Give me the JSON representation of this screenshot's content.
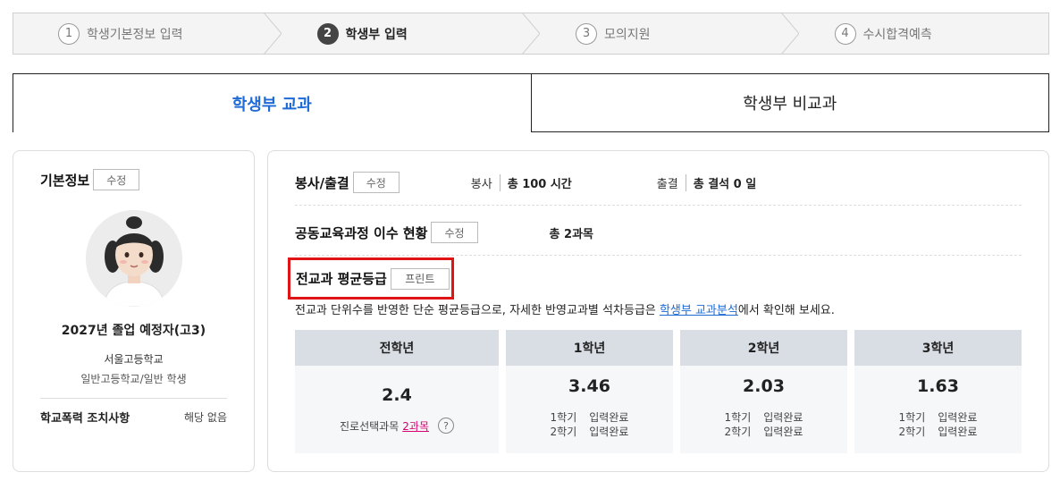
{
  "stepper": {
    "steps": [
      {
        "num": "1",
        "label": "학생기본정보 입력"
      },
      {
        "num": "2",
        "label": "학생부 입력"
      },
      {
        "num": "3",
        "label": "모의지원"
      },
      {
        "num": "4",
        "label": "수시합격예측"
      }
    ]
  },
  "tabs": {
    "curricular": "학생부 교과",
    "non_curricular": "학생부 비교과"
  },
  "basic_info": {
    "title": "기본정보",
    "edit_label": "수정",
    "graduation": "2027년 졸업 예정자(고3)",
    "school": "서울고등학교",
    "school_type": "일반고등학교/일반 학생",
    "violence_label": "학교폭력 조치사항",
    "violence_value": "해당 없음"
  },
  "service": {
    "title": "봉사/출결",
    "edit_label": "수정",
    "volunteer_label": "봉사",
    "volunteer_value": "총 100 시간",
    "attendance_label": "출결",
    "attendance_value": "총 결석 0 일"
  },
  "common_course": {
    "title": "공동교육과정 이수 현황",
    "edit_label": "수정",
    "value": "총 2과목"
  },
  "avg_grade": {
    "title": "전교과 평균등급",
    "print_label": "프린트",
    "desc_pre": "전교과 단위수를 반영한 단순 평균등급으로, 자세한 반영교과별 석차등급은 ",
    "desc_link": "학생부 교과분석",
    "desc_post": "에서 확인해 보세요.",
    "all": {
      "header": "전학년",
      "value": "2.4",
      "career_label": "진로선택과목",
      "career_count": "2과목",
      "help": "?"
    },
    "years": [
      {
        "header": "1학년",
        "value": "3.46",
        "sem1": "1학기",
        "sem1_status": "입력완료",
        "sem2": "2학기",
        "sem2_status": "입력완료"
      },
      {
        "header": "2학년",
        "value": "2.03",
        "sem1": "1학기",
        "sem1_status": "입력완료",
        "sem2": "2학기",
        "sem2_status": "입력완료"
      },
      {
        "header": "3학년",
        "value": "1.63",
        "sem1": "1학기",
        "sem1_status": "입력완료",
        "sem2": "2학기",
        "sem2_status": "입력완료"
      }
    ]
  },
  "colors": {
    "accent": "#1e6bd6",
    "highlight": "#e01414",
    "link_pink": "#d6006f"
  }
}
